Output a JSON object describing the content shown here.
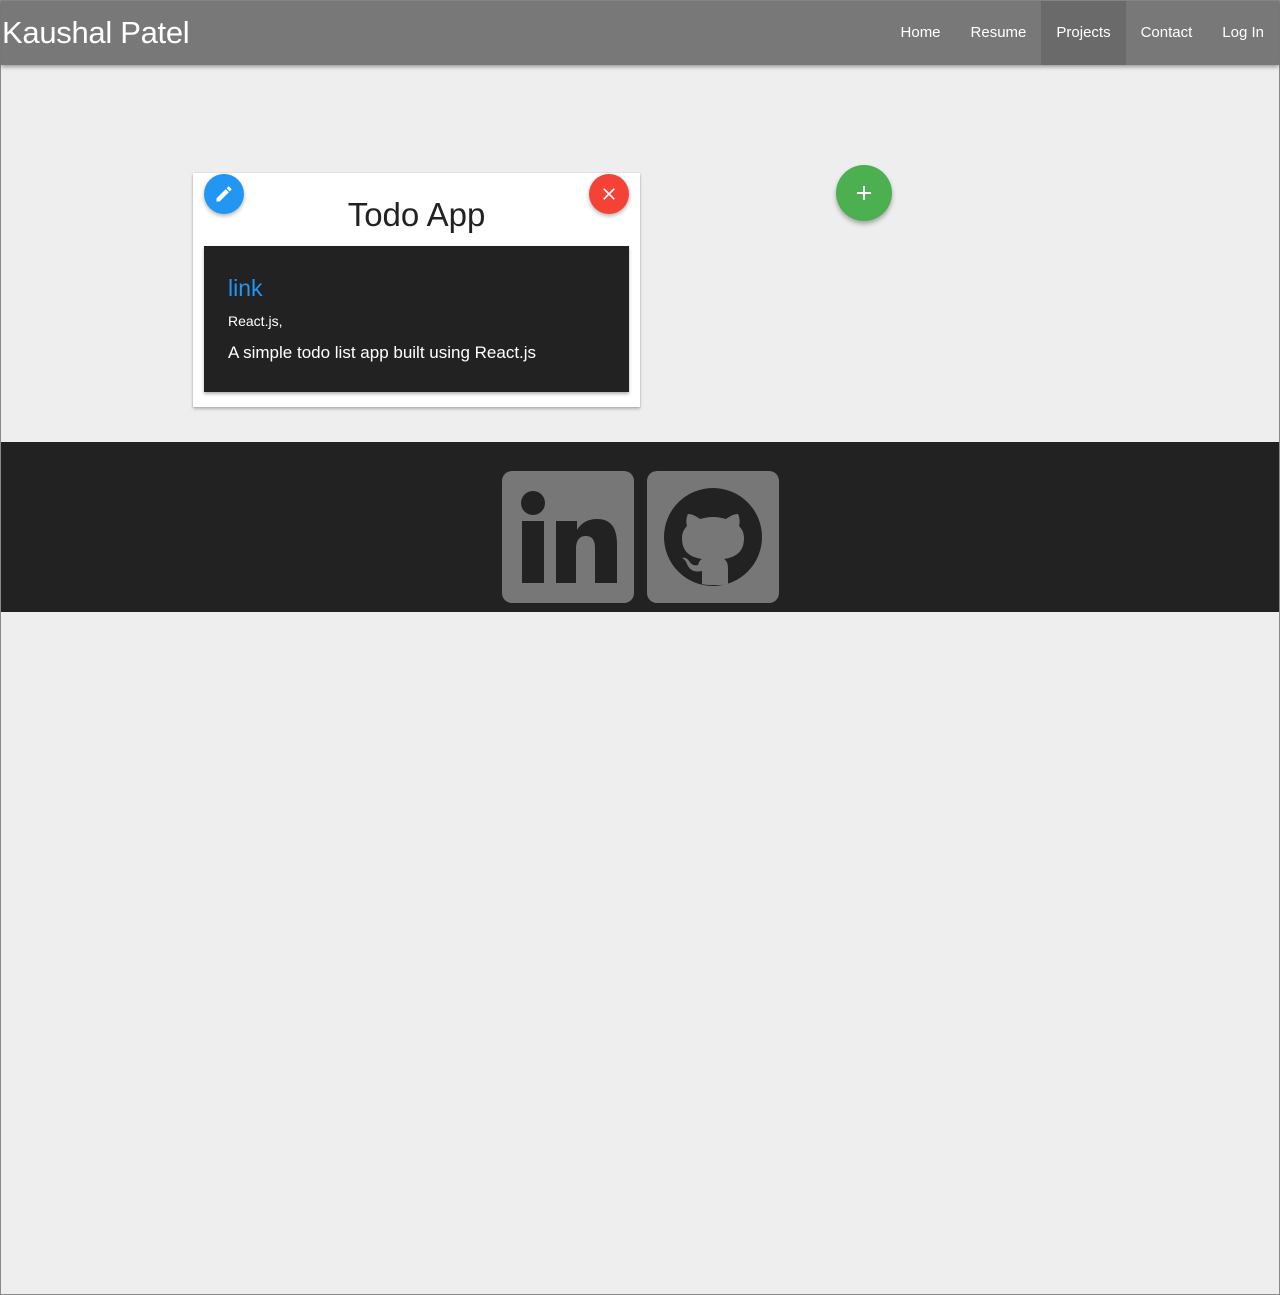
{
  "header": {
    "brand": "Kaushal Patel",
    "nav": [
      {
        "label": "Home"
      },
      {
        "label": "Resume"
      },
      {
        "label": "Projects",
        "active": true
      },
      {
        "label": "Contact"
      },
      {
        "label": "Log In"
      }
    ]
  },
  "project_card": {
    "title": "Todo App",
    "link_text": "link",
    "tech": "React.js,",
    "description": "A simple todo list app built using React.js",
    "edit_icon": "pencil-icon",
    "delete_icon": "close-icon"
  },
  "add_button": {
    "icon": "plus-icon"
  },
  "footer": {
    "social": [
      {
        "icon": "linkedin-icon"
      },
      {
        "icon": "github-icon"
      }
    ]
  },
  "colors": {
    "navbar": "#787878",
    "nav_active": "#6a6a6a",
    "page_bg": "#eeeeee",
    "card_body": "#222222",
    "link": "#2196f3",
    "edit_fab": "#2196f3",
    "delete_fab": "#f44336",
    "add_fab": "#4caf50",
    "footer": "#222222",
    "social_tile": "#777777"
  }
}
